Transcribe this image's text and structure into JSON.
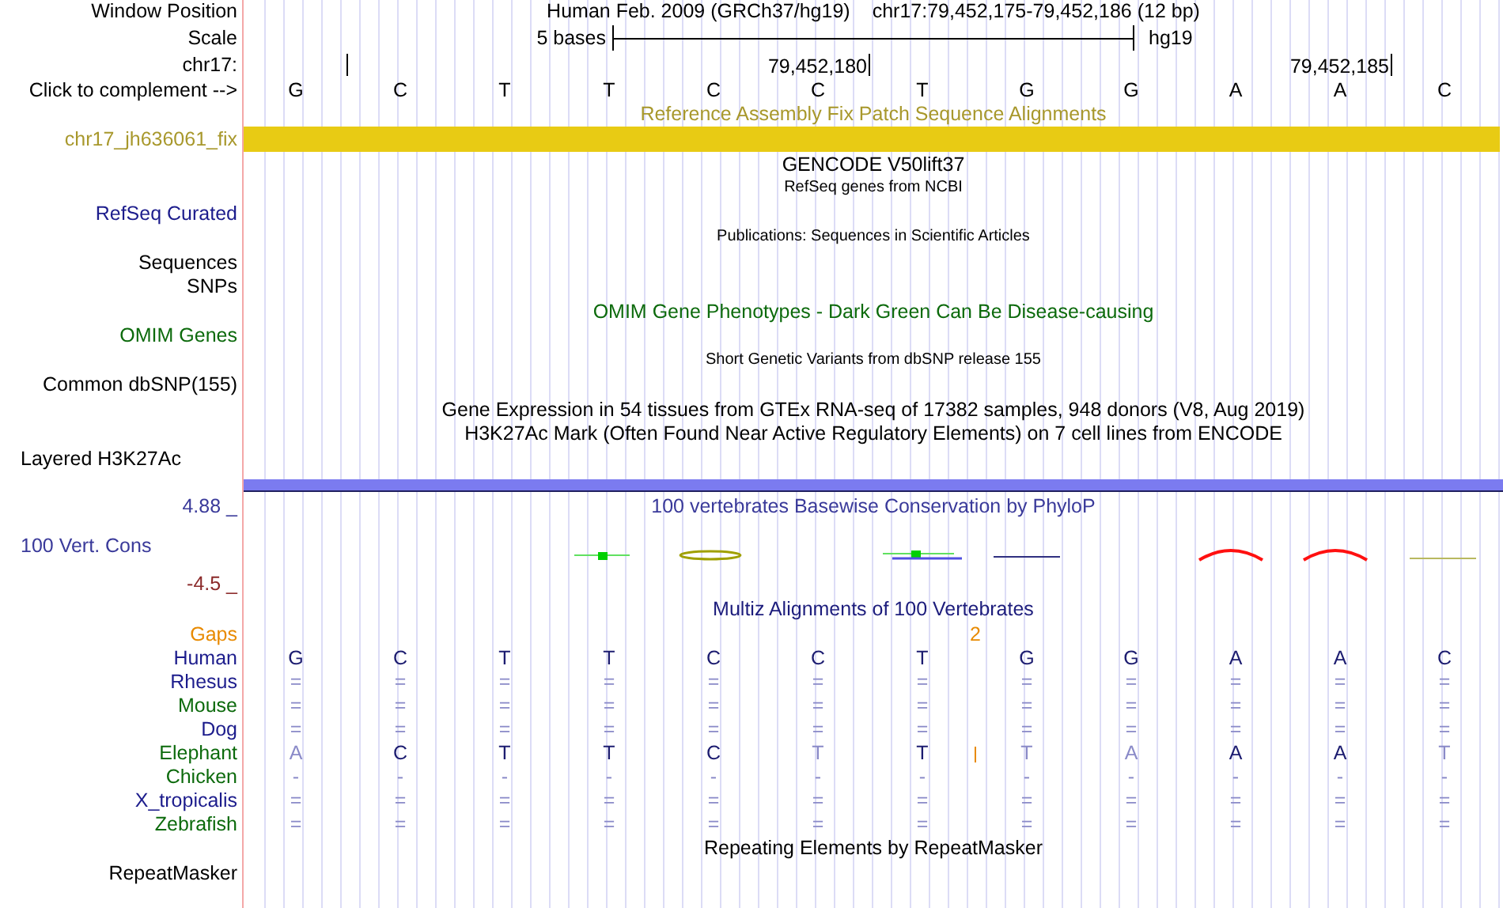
{
  "window_position": {
    "label": "Window Position",
    "assembly": "Human Feb. 2009 (GRCh37/hg19)",
    "range": "chr17:79,452,175-79,452,186 (12 bp)"
  },
  "scale": {
    "label": "Scale",
    "span": "5 bases",
    "assembly": "hg19"
  },
  "ruler": {
    "label": "chr17:",
    "ticks": [
      "79,452,180",
      "79,452,185"
    ]
  },
  "sequence": {
    "label": "Click to complement -->",
    "bases": [
      "G",
      "C",
      "T",
      "T",
      "C",
      "C",
      "T",
      "G",
      "G",
      "A",
      "A",
      "C"
    ]
  },
  "tracks": [
    {
      "kind": "bar",
      "title": {
        "text": "Reference Assembly Fix Patch Sequence Alignments",
        "color": "#a8982c",
        "small": false
      },
      "label": "chr17_jh636061_fix",
      "color": "#a8982c",
      "bar": {
        "color": "#e8cb14"
      }
    },
    {
      "kind": "track",
      "title": {
        "text": "GENCODE V50lift37",
        "color": "#000000",
        "small": false
      }
    },
    {
      "kind": "track",
      "title": {
        "text": "RefSeq genes from NCBI",
        "color": "#000000",
        "small": true
      },
      "label": "RefSeq Curated",
      "color": "#1c1c8c"
    },
    {
      "kind": "track",
      "title": {
        "text": "Publications: Sequences in Scientific Articles",
        "color": "#000000",
        "small": true
      },
      "label": "Sequences",
      "color": "#000000"
    },
    {
      "kind": "track",
      "label": "SNPs",
      "color": "#000000"
    },
    {
      "kind": "track",
      "title": {
        "text": "OMIM Gene Phenotypes - Dark Green Can Be Disease-causing",
        "color": "#0c6a0c",
        "small": false
      },
      "label": "OMIM Genes",
      "color": "#0c6a0c"
    },
    {
      "kind": "track",
      "title": {
        "text": "Short Genetic Variants from dbSNP release 155",
        "color": "#000000",
        "small": true
      },
      "label": "Common dbSNP(155)",
      "color": "#000000"
    },
    {
      "kind": "track",
      "title": {
        "text": "Gene Expression in 54 tissues from GTEx RNA-seq of 17382 samples, 948 donors (V8, Aug 2019)",
        "color": "#000000",
        "small": false
      }
    },
    {
      "kind": "signal",
      "title": {
        "text": "H3K27Ac Mark (Often Found Near Active Regulatory Elements) on 7 cell lines from ENCODE",
        "color": "#000000",
        "small": false
      },
      "label": "Layered H3K27Ac",
      "color": "#000000",
      "bar": {
        "color": "#7b7bf0"
      }
    },
    {
      "kind": "wiggle",
      "title": {
        "text": "100 vertebrates Basewise Conservation by PhyloP",
        "color": "#3a3a9a",
        "small": false
      },
      "label": "100 Vert. Cons",
      "color": "#3a3a9a",
      "axis_max": "4.88 _",
      "axis_min": "-4.5 _"
    },
    {
      "kind": "alignment",
      "title": {
        "text": "Multiz Alignments of 100 Vertebrates",
        "color": "#1c1c7c",
        "small": false
      },
      "gaps_label": "Gaps",
      "species": [
        {
          "name": "Human",
          "color": "#1c1c8c",
          "bases": [
            "G",
            "C",
            "T",
            "T",
            "C",
            "C",
            "T",
            "G",
            "G",
            "A",
            "A",
            "C"
          ]
        },
        {
          "name": "Rhesus",
          "color": "#1c1c8c",
          "bases": [
            "=",
            "=",
            "=",
            "=",
            "=",
            "=",
            "=",
            "=",
            "=",
            "=",
            "=",
            "="
          ]
        },
        {
          "name": "Mouse",
          "color": "#0c6a0c",
          "bases": [
            "=",
            "=",
            "=",
            "=",
            "=",
            "=",
            "=",
            "=",
            "=",
            "=",
            "=",
            "="
          ]
        },
        {
          "name": "Dog",
          "color": "#1c1c8c",
          "bases": [
            "=",
            "=",
            "=",
            "=",
            "=",
            "=",
            "=",
            "=",
            "=",
            "=",
            "=",
            "="
          ]
        },
        {
          "name": "Elephant",
          "color": "#0c6a0c",
          "bases": [
            "A",
            "C",
            "T",
            "T",
            "C",
            "T",
            {
              "base": "T",
              "insertion": "2"
            },
            "T",
            "A",
            "A",
            "A",
            "T"
          ]
        },
        {
          "name": "Chicken",
          "color": "#0c6a0c",
          "bases": [
            "-",
            "-",
            "-",
            "-",
            "-",
            "-",
            "-",
            "-",
            "-",
            "-",
            "-",
            "-"
          ]
        },
        {
          "name": "X_tropicalis",
          "color": "#1c1c8c",
          "bases": [
            "=",
            "=",
            "=",
            "=",
            "=",
            "=",
            "=",
            "=",
            "=",
            "=",
            "=",
            "="
          ]
        },
        {
          "name": "Zebrafish",
          "color": "#0c6a0c",
          "bases": [
            "=",
            "=",
            "=",
            "=",
            "=",
            "=",
            "=",
            "=",
            "=",
            "=",
            "=",
            "="
          ]
        }
      ]
    },
    {
      "kind": "track",
      "title": {
        "text": "Repeating Elements by RepeatMasker",
        "color": "#000000",
        "small": false
      },
      "label": "RepeatMasker",
      "color": "#000000"
    }
  ]
}
